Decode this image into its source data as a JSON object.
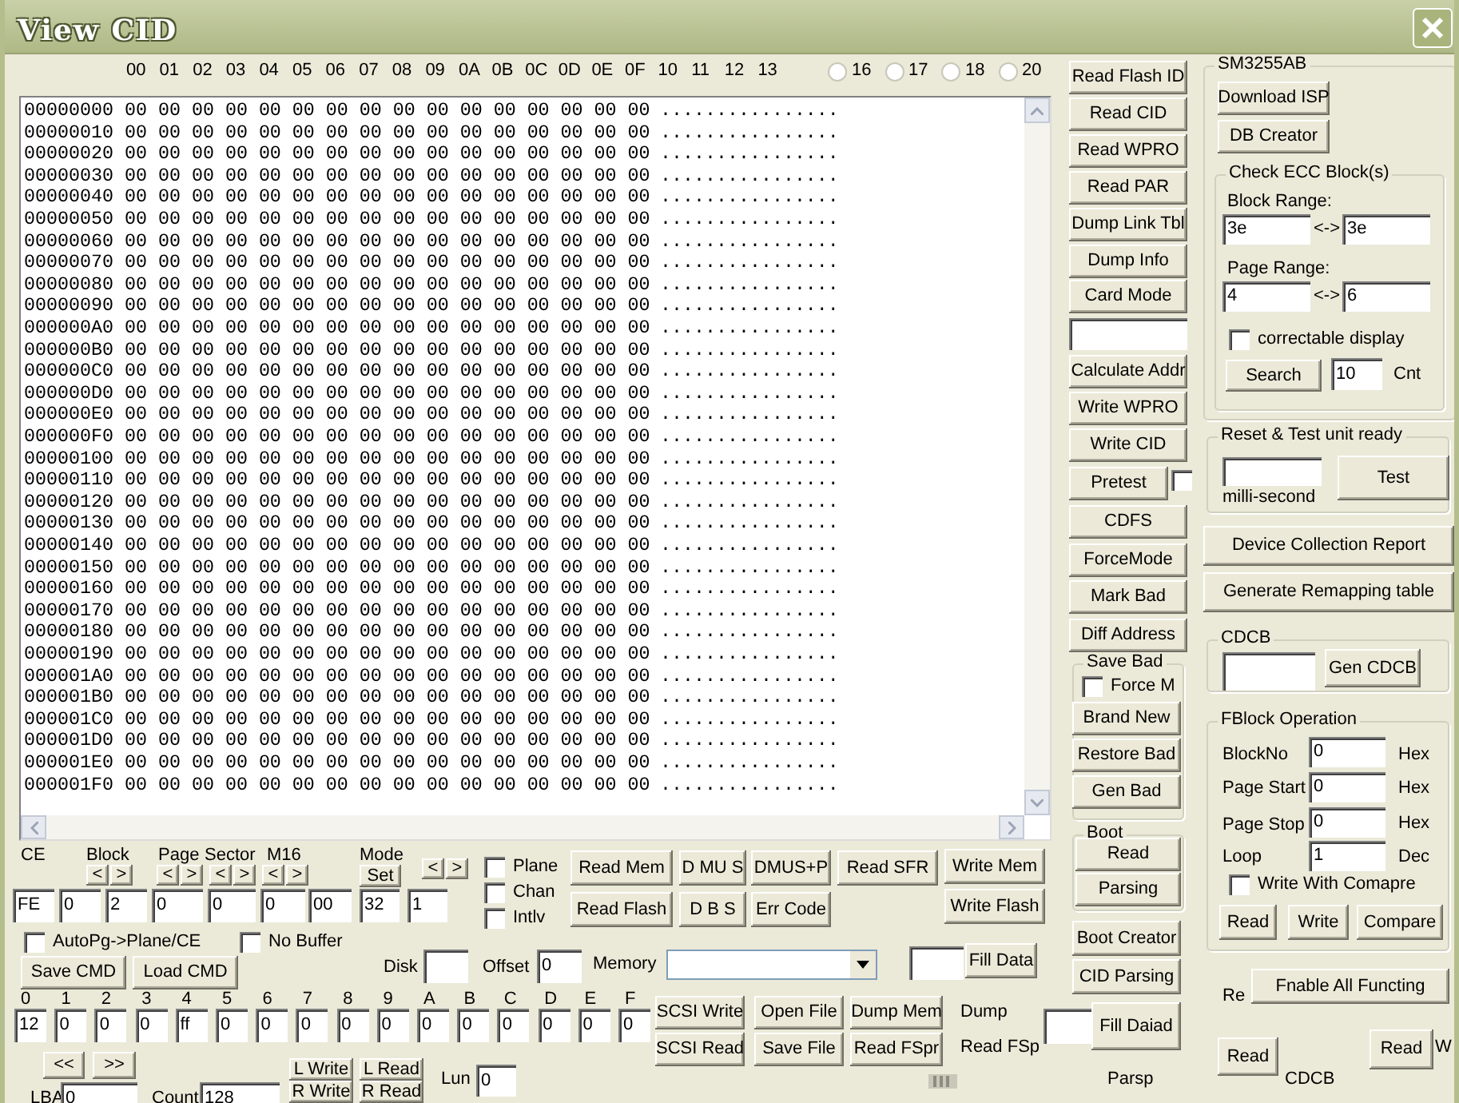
{
  "window": {
    "title": "View CID"
  },
  "hex_view": {
    "columns": [
      "00",
      "01",
      "02",
      "03",
      "04",
      "05",
      "06",
      "07",
      "08",
      "09",
      "0A",
      "0B",
      "0C",
      "0D",
      "0E",
      "0F",
      "10",
      "11",
      "12",
      "13"
    ],
    "width_options": [
      {
        "label": "16",
        "selected": false
      },
      {
        "label": "17",
        "selected": false
      },
      {
        "label": "18",
        "selected": false
      },
      {
        "label": "20",
        "selected": false
      }
    ],
    "rows": [
      {
        "address": "00000000",
        "hex": "00 00 00 00 00 00 00 00 00 00 00 00 00 00 00 00",
        "ascii": "................"
      },
      {
        "address": "00000010",
        "hex": "00 00 00 00 00 00 00 00 00 00 00 00 00 00 00 00",
        "ascii": "................"
      },
      {
        "address": "00000020",
        "hex": "00 00 00 00 00 00 00 00 00 00 00 00 00 00 00 00",
        "ascii": "................"
      },
      {
        "address": "00000030",
        "hex": "00 00 00 00 00 00 00 00 00 00 00 00 00 00 00 00",
        "ascii": "................"
      },
      {
        "address": "00000040",
        "hex": "00 00 00 00 00 00 00 00 00 00 00 00 00 00 00 00",
        "ascii": "................"
      },
      {
        "address": "00000050",
        "hex": "00 00 00 00 00 00 00 00 00 00 00 00 00 00 00 00",
        "ascii": "................"
      },
      {
        "address": "00000060",
        "hex": "00 00 00 00 00 00 00 00 00 00 00 00 00 00 00 00",
        "ascii": "................"
      },
      {
        "address": "00000070",
        "hex": "00 00 00 00 00 00 00 00 00 00 00 00 00 00 00 00",
        "ascii": "................"
      },
      {
        "address": "00000080",
        "hex": "00 00 00 00 00 00 00 00 00 00 00 00 00 00 00 00",
        "ascii": "................"
      },
      {
        "address": "00000090",
        "hex": "00 00 00 00 00 00 00 00 00 00 00 00 00 00 00 00",
        "ascii": "................"
      },
      {
        "address": "000000A0",
        "hex": "00 00 00 00 00 00 00 00 00 00 00 00 00 00 00 00",
        "ascii": "................"
      },
      {
        "address": "000000B0",
        "hex": "00 00 00 00 00 00 00 00 00 00 00 00 00 00 00 00",
        "ascii": "................"
      },
      {
        "address": "000000C0",
        "hex": "00 00 00 00 00 00 00 00 00 00 00 00 00 00 00 00",
        "ascii": "................"
      },
      {
        "address": "000000D0",
        "hex": "00 00 00 00 00 00 00 00 00 00 00 00 00 00 00 00",
        "ascii": "................"
      },
      {
        "address": "000000E0",
        "hex": "00 00 00 00 00 00 00 00 00 00 00 00 00 00 00 00",
        "ascii": "................"
      },
      {
        "address": "000000F0",
        "hex": "00 00 00 00 00 00 00 00 00 00 00 00 00 00 00 00",
        "ascii": "................"
      },
      {
        "address": "00000100",
        "hex": "00 00 00 00 00 00 00 00 00 00 00 00 00 00 00 00",
        "ascii": "................"
      },
      {
        "address": "00000110",
        "hex": "00 00 00 00 00 00 00 00 00 00 00 00 00 00 00 00",
        "ascii": "................"
      },
      {
        "address": "00000120",
        "hex": "00 00 00 00 00 00 00 00 00 00 00 00 00 00 00 00",
        "ascii": "................"
      },
      {
        "address": "00000130",
        "hex": "00 00 00 00 00 00 00 00 00 00 00 00 00 00 00 00",
        "ascii": "................"
      },
      {
        "address": "00000140",
        "hex": "00 00 00 00 00 00 00 00 00 00 00 00 00 00 00 00",
        "ascii": "................"
      },
      {
        "address": "00000150",
        "hex": "00 00 00 00 00 00 00 00 00 00 00 00 00 00 00 00",
        "ascii": "................"
      },
      {
        "address": "00000160",
        "hex": "00 00 00 00 00 00 00 00 00 00 00 00 00 00 00 00",
        "ascii": "................"
      },
      {
        "address": "00000170",
        "hex": "00 00 00 00 00 00 00 00 00 00 00 00 00 00 00 00",
        "ascii": "................"
      },
      {
        "address": "00000180",
        "hex": "00 00 00 00 00 00 00 00 00 00 00 00 00 00 00 00",
        "ascii": "................"
      },
      {
        "address": "00000190",
        "hex": "00 00 00 00 00 00 00 00 00 00 00 00 00 00 00 00",
        "ascii": "................"
      },
      {
        "address": "000001A0",
        "hex": "00 00 00 00 00 00 00 00 00 00 00 00 00 00 00 00",
        "ascii": "................"
      },
      {
        "address": "000001B0",
        "hex": "00 00 00 00 00 00 00 00 00 00 00 00 00 00 00 00",
        "ascii": "................"
      },
      {
        "address": "000001C0",
        "hex": "00 00 00 00 00 00 00 00 00 00 00 00 00 00 00 00",
        "ascii": "................"
      },
      {
        "address": "000001D0",
        "hex": "00 00 00 00 00 00 00 00 00 00 00 00 00 00 00 00",
        "ascii": "................"
      },
      {
        "address": "000001E0",
        "hex": "00 00 00 00 00 00 00 00 00 00 00 00 00 00 00 00",
        "ascii": "................"
      },
      {
        "address": "000001F0",
        "hex": "00 00 00 00 00 00 00 00 00 00 00 00 00 00 00 00",
        "ascii": "................"
      }
    ]
  },
  "command_column": [
    {
      "kind": "button",
      "label": "Read Flash ID"
    },
    {
      "kind": "button",
      "label": "Read CID"
    },
    {
      "kind": "button",
      "label": "Read WPRO"
    },
    {
      "kind": "button",
      "label": "Read PAR"
    },
    {
      "kind": "button",
      "label": "Dump Link Tbl"
    },
    {
      "kind": "button",
      "label": "Dump Info"
    },
    {
      "kind": "button",
      "label": "Card Mode"
    },
    {
      "kind": "field"
    },
    {
      "kind": "button",
      "label": "Calculate Addr"
    },
    {
      "kind": "button",
      "label": "Write WPRO"
    },
    {
      "kind": "button",
      "label": "Write CID"
    },
    {
      "kind": "button",
      "label": "Pretest"
    },
    {
      "kind": "checkbox",
      "checked": false
    },
    {
      "kind": "button",
      "label": "CDFS"
    },
    {
      "kind": "button",
      "label": "ForceMode"
    },
    {
      "kind": "button",
      "label": "Mark Bad"
    },
    {
      "kind": "button",
      "label": "Diff Address"
    },
    {
      "kind": "group",
      "title": "Save Bad"
    },
    {
      "kind": "checkbox",
      "label": "Force M",
      "checked": false
    },
    {
      "kind": "button",
      "label": "Brand New"
    },
    {
      "kind": "button",
      "label": "Restore Bad"
    },
    {
      "kind": "button",
      "label": "Gen Bad"
    },
    {
      "kind": "group",
      "title": "Boot"
    },
    {
      "kind": "button",
      "label": "Read"
    },
    {
      "kind": "button",
      "label": "Parsing"
    },
    {
      "kind": "button",
      "label": "Boot Creator"
    },
    {
      "kind": "button",
      "label": "CID Parsing"
    },
    {
      "kind": "field"
    },
    {
      "kind": "button",
      "label": "Fill Daiad"
    },
    {
      "kind": "label",
      "text": "Parsp"
    }
  ],
  "side_panel": [
    {
      "kind": "group",
      "title": "SM3255AB"
    },
    {
      "kind": "button",
      "label": "Download ISP"
    },
    {
      "kind": "button",
      "label": "DB Creator"
    },
    {
      "kind": "group",
      "title": "Check ECC Block(s)"
    },
    {
      "kind": "label",
      "text": "Block Range:"
    },
    {
      "kind": "field",
      "value": "3e"
    },
    {
      "kind": "label",
      "text": "<->"
    },
    {
      "kind": "field",
      "value": "3e"
    },
    {
      "kind": "label",
      "text": "Page Range:"
    },
    {
      "kind": "field",
      "value": "4"
    },
    {
      "kind": "label",
      "text": "<->"
    },
    {
      "kind": "field",
      "value": "6"
    },
    {
      "kind": "checkbox",
      "label": "correctable display",
      "checked": false
    },
    {
      "kind": "button",
      "label": "Search"
    },
    {
      "kind": "field",
      "value": "10"
    },
    {
      "kind": "label",
      "text": "Cnt"
    },
    {
      "kind": "group",
      "title": "Reset & Test unit ready"
    },
    {
      "kind": "field"
    },
    {
      "kind": "label",
      "text": "milli-second"
    },
    {
      "kind": "button",
      "label": "Test"
    },
    {
      "kind": "button",
      "label": "Device Collection Report"
    },
    {
      "kind": "button",
      "label": "Generate Remapping table"
    },
    {
      "kind": "group",
      "title": "CDCB"
    },
    {
      "kind": "field"
    },
    {
      "kind": "button",
      "label": "Gen CDCB"
    },
    {
      "kind": "group",
      "title": "FBlock Operation"
    },
    {
      "kind": "label",
      "text": "BlockNo"
    },
    {
      "kind": "field",
      "value": "0"
    },
    {
      "kind": "label",
      "text": "Hex"
    },
    {
      "kind": "label",
      "text": "Page Start"
    },
    {
      "kind": "field",
      "value": "0"
    },
    {
      "kind": "label",
      "text": "Hex"
    },
    {
      "kind": "label",
      "text": "Page Stop"
    },
    {
      "kind": "field",
      "value": "0"
    },
    {
      "kind": "label",
      "text": "Hex"
    },
    {
      "kind": "label",
      "text": "Loop"
    },
    {
      "kind": "field",
      "value": "1"
    },
    {
      "kind": "label",
      "text": "Dec"
    },
    {
      "kind": "checkbox",
      "label": "Write With Comapre",
      "checked": false
    },
    {
      "kind": "button",
      "label": "Read"
    },
    {
      "kind": "button",
      "label": "Write"
    },
    {
      "kind": "button",
      "label": "Compare"
    },
    {
      "kind": "label",
      "text": "Re"
    },
    {
      "kind": "button",
      "label": "Fnable All Functing"
    },
    {
      "kind": "button",
      "label": "Read"
    },
    {
      "kind": "label",
      "text": "CDCB"
    },
    {
      "kind": "button",
      "label": "Read"
    },
    {
      "kind": "label",
      "text": "W"
    }
  ],
  "address_panel": [
    {
      "kind": "label",
      "text": "CE"
    },
    {
      "kind": "label",
      "text": "Block"
    },
    {
      "kind": "label",
      "text": "Page"
    },
    {
      "kind": "label",
      "text": "Sector"
    },
    {
      "kind": "label",
      "text": "M16"
    },
    {
      "kind": "label",
      "text": "Mode"
    },
    {
      "kind": "button",
      "label": "<"
    },
    {
      "kind": "button",
      "label": ">"
    },
    {
      "kind": "button",
      "label": "<"
    },
    {
      "kind": "button",
      "label": ">"
    },
    {
      "kind": "button",
      "label": "<"
    },
    {
      "kind": "button",
      "label": ">"
    },
    {
      "kind": "button",
      "label": "<"
    },
    {
      "kind": "button",
      "label": ">"
    },
    {
      "kind": "button",
      "label": "Set"
    },
    {
      "kind": "button",
      "label": "<"
    },
    {
      "kind": "button",
      "label": ">"
    },
    {
      "kind": "field",
      "value": "FE"
    },
    {
      "kind": "field",
      "value": "0"
    },
    {
      "kind": "field",
      "value": "2"
    },
    {
      "kind": "field",
      "value": "0"
    },
    {
      "kind": "field",
      "value": "0"
    },
    {
      "kind": "field",
      "value": "0"
    },
    {
      "kind": "field",
      "value": "00"
    },
    {
      "kind": "field",
      "value": "32"
    },
    {
      "kind": "field",
      "value": "1"
    },
    {
      "kind": "checkbox",
      "label": "Plane",
      "checked": false
    },
    {
      "kind": "checkbox",
      "label": "Chan",
      "checked": false
    },
    {
      "kind": "checkbox",
      "label": "Intlv",
      "checked": false
    },
    {
      "kind": "button",
      "label": "Read Mem"
    },
    {
      "kind": "button",
      "label": "Read Flash"
    },
    {
      "kind": "button",
      "label": "D MU S"
    },
    {
      "kind": "button",
      "label": "D B S"
    },
    {
      "kind": "button",
      "label": "DMUS+P"
    },
    {
      "kind": "button",
      "label": "Err Code"
    },
    {
      "kind": "button",
      "label": "Read SFR"
    },
    {
      "kind": "button",
      "label": "Write Mem"
    },
    {
      "kind": "button",
      "label": "Write Flash"
    },
    {
      "kind": "checkbox",
      "label": "AutoPg->Plane/CE",
      "checked": false
    },
    {
      "kind": "checkbox",
      "label": "No Buffer",
      "checked": false
    },
    {
      "kind": "button",
      "label": "Save CMD"
    },
    {
      "kind": "button",
      "label": "Load CMD"
    },
    {
      "kind": "label",
      "text": "Disk"
    },
    {
      "kind": "field"
    },
    {
      "kind": "label",
      "text": "Offset"
    },
    {
      "kind": "field",
      "value": "0"
    },
    {
      "kind": "label",
      "text": "Memory"
    },
    {
      "kind": "dropdown"
    },
    {
      "kind": "field"
    },
    {
      "kind": "button",
      "label": "Fill Data"
    }
  ],
  "command_bytes": {
    "labels": [
      "0",
      "1",
      "2",
      "3",
      "4",
      "5",
      "6",
      "7",
      "8",
      "9",
      "A",
      "B",
      "C",
      "D",
      "E",
      "F"
    ],
    "values": [
      "12",
      "0",
      "0",
      "0",
      "ff",
      "0",
      "0",
      "0",
      "0",
      "0",
      "0",
      "0",
      "0",
      "0",
      "0",
      "0"
    ]
  },
  "transfer_panel": [
    {
      "kind": "button",
      "label": "SCSI Write"
    },
    {
      "kind": "button",
      "label": "SCSI Read"
    },
    {
      "kind": "button",
      "label": "Open File"
    },
    {
      "kind": "button",
      "label": "Save File"
    },
    {
      "kind": "button",
      "label": "Dump Mem"
    },
    {
      "kind": "button",
      "label": "Read FSpr"
    },
    {
      "kind": "label",
      "text": "Dump"
    },
    {
      "kind": "label",
      "text": "Read FSp"
    },
    {
      "kind": "button",
      "label": "<<"
    },
    {
      "kind": "button",
      "label": ">>"
    },
    {
      "kind": "label",
      "text": "LBA"
    },
    {
      "kind": "field",
      "value": "0"
    },
    {
      "kind": "label",
      "text": "Count"
    },
    {
      "kind": "field",
      "value": "128"
    },
    {
      "kind": "button",
      "label": "L Write"
    },
    {
      "kind": "button",
      "label": "R Write"
    },
    {
      "kind": "button",
      "label": "L Read"
    },
    {
      "kind": "button",
      "label": "R Read"
    },
    {
      "kind": "label",
      "text": "Lun"
    },
    {
      "kind": "field",
      "value": "0"
    },
    {
      "kind": "grip"
    }
  ]
}
